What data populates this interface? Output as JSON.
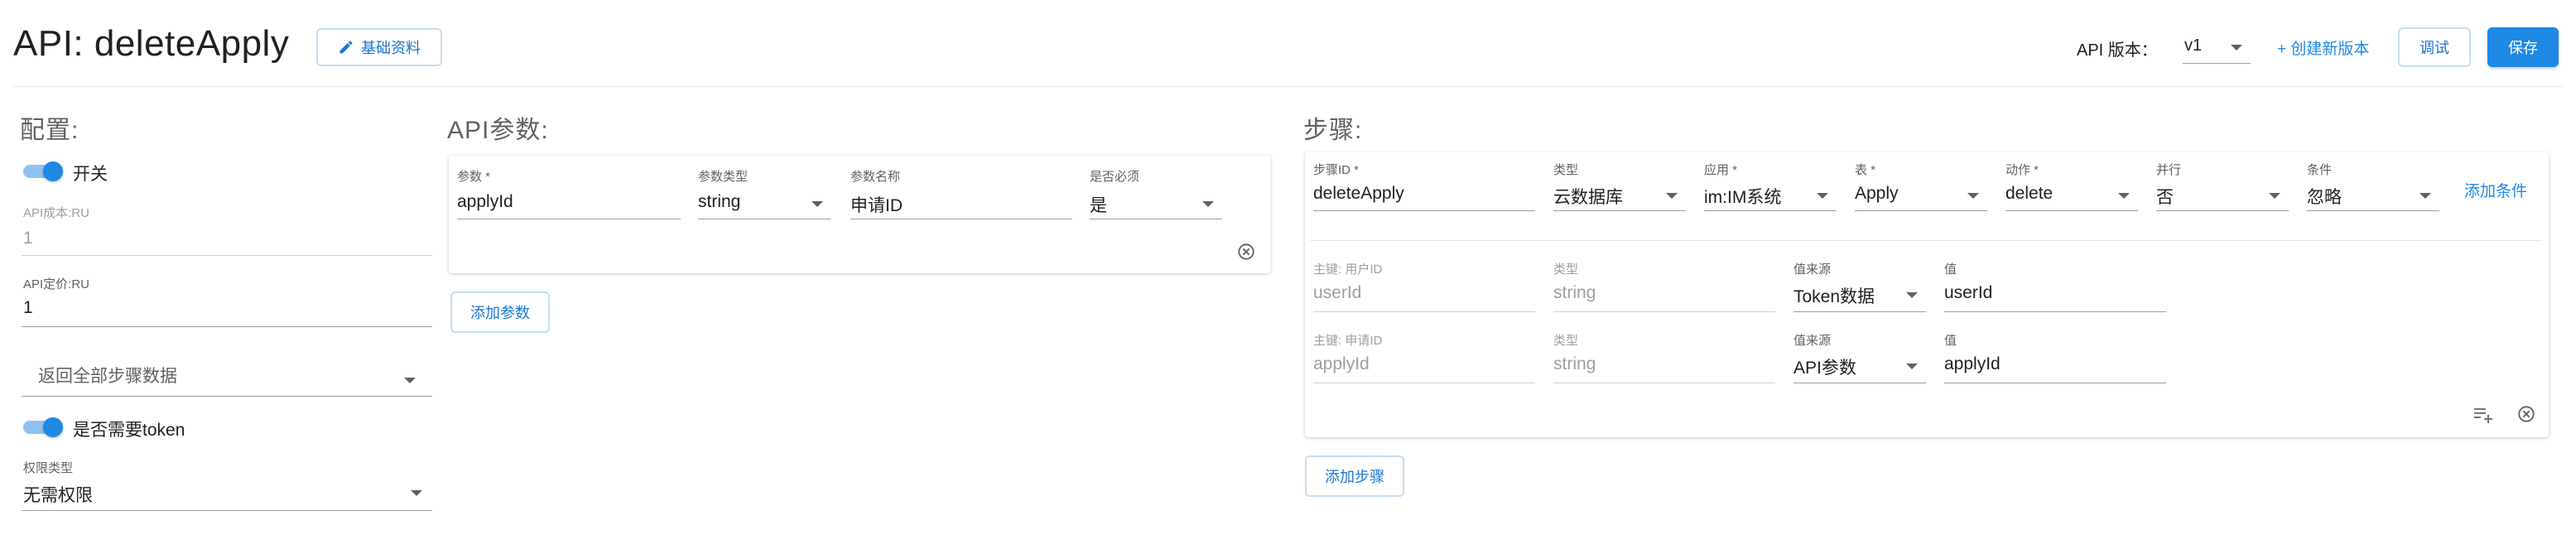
{
  "header": {
    "title": "API: deleteApply",
    "basic_info_button": "基础资料",
    "api_version_label": "API 版本：",
    "api_version_value": "v1",
    "create_version_link": "+ 创建新版本",
    "debug_button": "调试",
    "save_button": "保存"
  },
  "config": {
    "title": "配置:",
    "switch_label": "开关",
    "api_cost_label": "API成本:RU",
    "api_cost_value": "1",
    "api_price_label": "API定价:RU",
    "api_price_value": "1",
    "return_select_placeholder": "返回全部步骤数据",
    "token_label": "是否需要token",
    "permission_label": "权限类型",
    "permission_value": "无需权限"
  },
  "params": {
    "title": "API参数:",
    "param_label": "参数 *",
    "param_value": "applyId",
    "type_label": "参数类型",
    "type_value": "string",
    "name_label": "参数名称",
    "name_value": "申请ID",
    "required_label": "是否必须",
    "required_value": "是",
    "add_button": "添加参数"
  },
  "steps": {
    "title": "步骤:",
    "step": {
      "id_label": "步骤ID *",
      "id_value": "deleteApply",
      "type_label": "类型",
      "type_value": "云数据库",
      "app_label": "应用 *",
      "app_value": "im:IM系统",
      "table_label": "表 *",
      "table_value": "Apply",
      "action_label": "动作 *",
      "action_value": "delete",
      "parallel_label": "并行",
      "parallel_value": "否",
      "condition_label": "条件",
      "condition_value": "忽略",
      "add_condition_link": "添加条件"
    },
    "keys": [
      {
        "key_label": "主键: 用户ID",
        "key_value": "userId",
        "type_label": "类型",
        "type_value": "string",
        "source_label": "值来源",
        "source_value": "Token数据",
        "value_label": "值",
        "value_value": "userId"
      },
      {
        "key_label": "主键: 申请ID",
        "key_value": "applyId",
        "type_label": "类型",
        "type_value": "string",
        "source_label": "值来源",
        "source_value": "API参数",
        "value_label": "值",
        "value_value": "applyId"
      }
    ],
    "add_button": "添加步骤"
  },
  "colors": {
    "accent": "#1e88e5",
    "toggle_track": "#90c2ee",
    "text": "#212121",
    "muted": "#9e9e9e"
  },
  "icons": {
    "basic_info": "pencil-icon",
    "remove": "circle-x-icon",
    "add_list": "playlist-add-icon",
    "dropdown": "caret-down-icon"
  }
}
